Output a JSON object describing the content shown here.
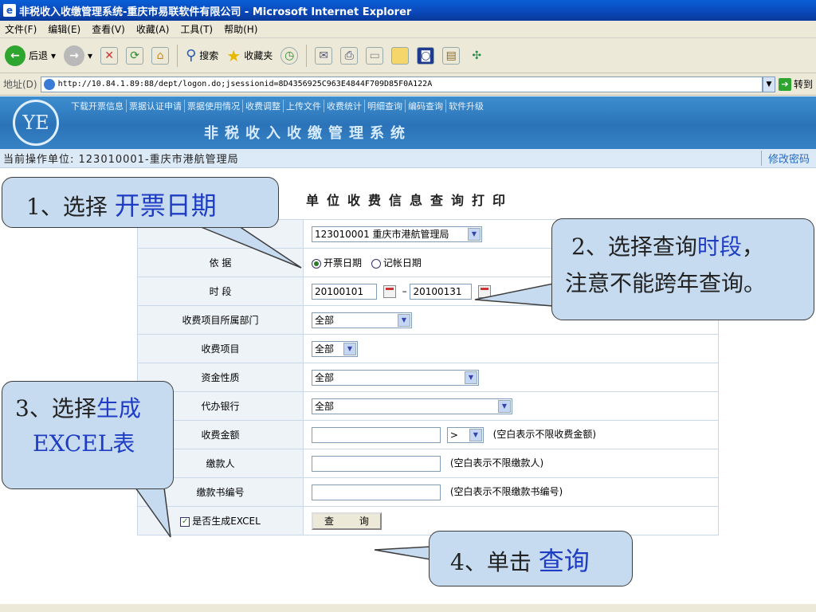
{
  "window": {
    "title": "非税收入收缴管理系统-重庆市易联软件有限公司 - Microsoft Internet Explorer"
  },
  "menu": [
    "文件(F)",
    "编辑(E)",
    "查看(V)",
    "收藏(A)",
    "工具(T)",
    "帮助(H)"
  ],
  "toolbar": {
    "back": "后退",
    "search": "搜索",
    "favorites": "收藏夹"
  },
  "address": {
    "label": "地址(D)",
    "url": "http://10.84.1.89:88/dept/logon.do;jsessionid=8D4356925C963E4844F709D85F0A122A",
    "go": "转到"
  },
  "site": {
    "logo": "YE",
    "nav": [
      "下载开票信息",
      "票据认证申请",
      "票据使用情况",
      "收费调整",
      "上传文件",
      "收费统计",
      "明细查询",
      "编码查询",
      "软件升级"
    ],
    "title": "非税收入收缴管理系统"
  },
  "unitbar": {
    "unit": "当前操作单位: 123010001-重庆市港航管理局",
    "change_password": "修改密码"
  },
  "form": {
    "title": "单位收费信息查询打印",
    "unit_select": "123010001 重庆市港航管理局",
    "basis_label": "依 据",
    "basis_opt1": "开票日期",
    "basis_opt2": "记帐日期",
    "period_label": "时 段",
    "period_from": "20100101",
    "period_sep": "–",
    "period_to": "20100131",
    "dept_label": "收费项目所属部门",
    "dept_value": "全部",
    "item_label": "收费项目",
    "item_value": "全部",
    "nature_label": "资金性质",
    "nature_value": "全部",
    "bank_label": "代办银行",
    "bank_value": "全部",
    "amount_label": "收费金额",
    "amount_op": ">",
    "amount_hint": "(空白表示不限收费金额)",
    "payer_label": "缴款人",
    "payer_hint": "(空白表示不限缴款人)",
    "bookno_label": "缴款书编号",
    "bookno_hint": "(空白表示不限缴款书编号)",
    "excel_label": "是否生成EXCEL",
    "query_button": "查 询"
  },
  "callouts": {
    "c1_prefix": "1、选择",
    "c1_blue": "开票日期",
    "c2_line1a": "2、选择查询",
    "c2_line1b": "时段",
    "c2_line1c": "，",
    "c2_line2": "注意不能跨年查询。",
    "c3_prefix": "3、选择",
    "c3_blue": "生成",
    "c3_line2": "EXCEL表",
    "c4_prefix": "4、单击",
    "c4_blue": "查询"
  }
}
